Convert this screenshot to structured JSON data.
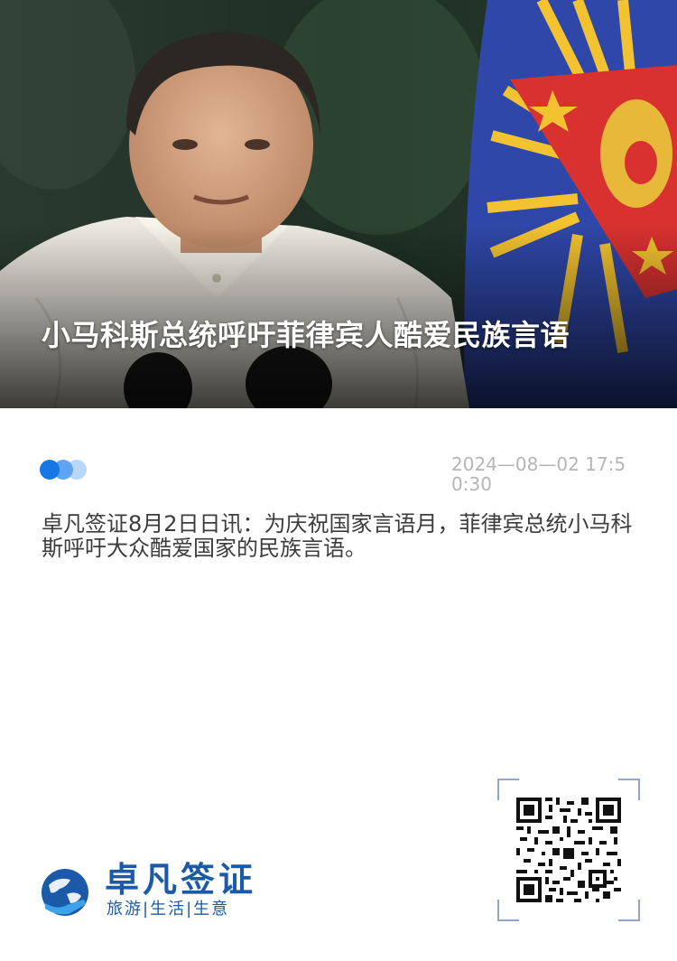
{
  "hero": {
    "title": "小马科斯总统呼吁菲律宾人酷爱民族言语"
  },
  "meta": {
    "timestamp": "2024—08—02 17:50:30",
    "loading_indicator": "three-dots-icon"
  },
  "article": {
    "body": "卓凡签证8月2日日讯：为庆祝国家言语月，菲律宾总统小马科斯呼吁大众酷爱国家的民族言语。"
  },
  "brand": {
    "name": "卓凡签证",
    "slogan": "旅游|生活|生意",
    "logo_icon": "globe-hand-logo-icon"
  },
  "qr": {
    "icon": "qr-code-icon"
  },
  "colors": {
    "brand_blue": "#1a5aa8",
    "dot_primary": "#1677e6",
    "timestamp_gray": "#b5b5b5",
    "body_text": "#3c3c3c"
  }
}
